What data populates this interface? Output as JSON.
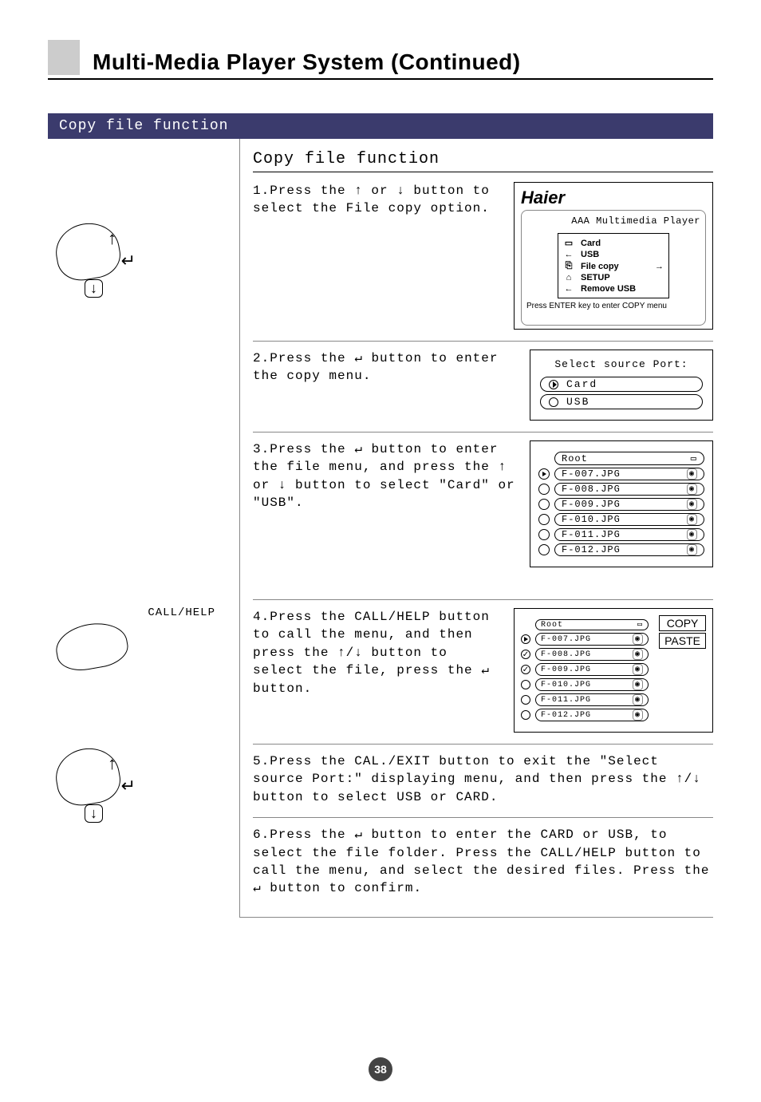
{
  "header": {
    "title": "Multi-Media Player System (Continued)"
  },
  "sectionBar": "Copy file function",
  "subTitle": "Copy file function",
  "steps": {
    "s1": "1.Press the ↑ or ↓ button to select the File copy option.",
    "s2": "2.Press the ↵ button to enter the copy menu.",
    "s3": "3.Press the ↵ button to enter the file menu, and press the ↑ or ↓ button to select \"Card\" or \"USB\".",
    "s4": "4.Press the CALL/HELP button to call the menu, and then press the ↑/↓ button to select the file, press the ↵ button.",
    "s5": "5.Press the CAL./EXIT button to exit the \"Select source Port:\" displaying menu, and then press the ↑/↓ button to select USB or CARD.",
    "s6": "6.Press the ↵ button to enter the CARD or USB, to select the file folder. Press the CALL/HELP button to call the menu, and select the desired files. Press the ↵ button to confirm."
  },
  "leftLabel": "CALL/HELP",
  "osd1": {
    "brand": "Haier",
    "subtitle": "AAA Multimedia Player",
    "items": [
      {
        "icon": "▭",
        "label": "Card"
      },
      {
        "icon": "←",
        "label": "USB"
      },
      {
        "icon": "⎘",
        "label": "File copy",
        "arrow": "→"
      },
      {
        "icon": "⌂",
        "label": "SETUP"
      },
      {
        "icon": "←",
        "label": "Remove USB"
      }
    ],
    "hint": "Press ENTER key to enter COPY menu"
  },
  "osd2": {
    "title": "Select source Port:",
    "options": [
      "Card",
      "USB"
    ]
  },
  "osd3": {
    "root": "Root",
    "files": [
      "F-007.JPG",
      "F-008.JPG",
      "F-009.JPG",
      "F-010.JPG",
      "F-011.JPG",
      "F-012.JPG"
    ]
  },
  "osd4": {
    "root": "Root",
    "files": [
      "F-007.JPG",
      "F-008.JPG",
      "F-009.JPG",
      "F-010.JPG",
      "F-011.JPG",
      "F-012.JPG"
    ],
    "copy": "COPY",
    "paste": "PASTE"
  },
  "pageNumber": "38"
}
